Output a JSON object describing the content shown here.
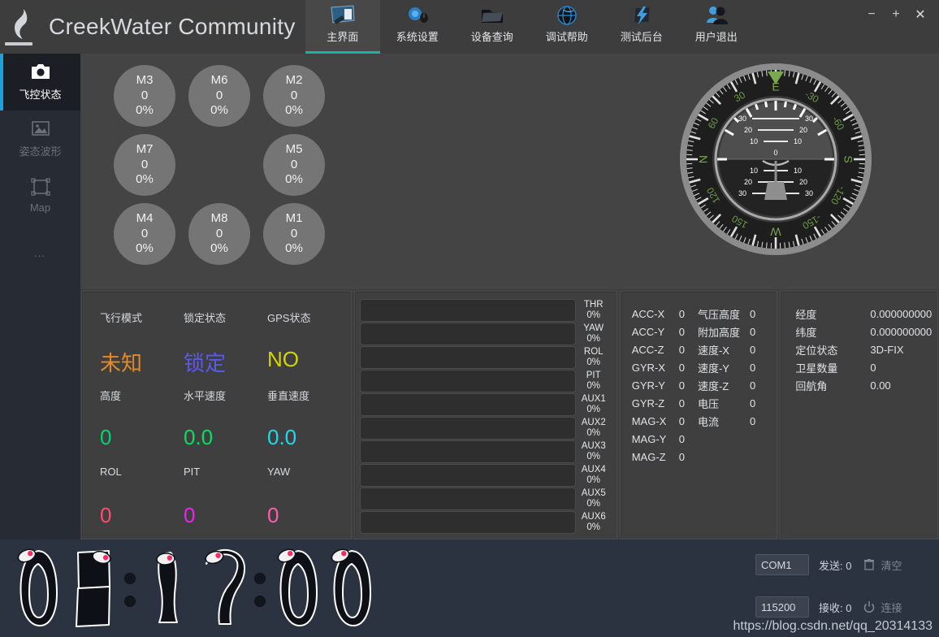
{
  "window": {
    "title": "CreekWater Community",
    "logo_icon": "flame-logo-icon",
    "minimize_label": "−",
    "maximize_label": "+",
    "close_label": "✕"
  },
  "tabs": [
    {
      "label": "主界面",
      "icon": "monitor-icon",
      "active": true
    },
    {
      "label": "系统设置",
      "icon": "mouse-gear-icon",
      "active": false
    },
    {
      "label": "设备查询",
      "icon": "folder-icon",
      "active": false
    },
    {
      "label": "调试帮助",
      "icon": "globe-icon",
      "active": false
    },
    {
      "label": "测试后台",
      "icon": "lightning-icon",
      "active": false
    },
    {
      "label": "用户退出",
      "icon": "users-icon",
      "active": false
    }
  ],
  "sidebar": {
    "items": [
      {
        "label": "飞控状态",
        "icon": "camera-icon",
        "active": true
      },
      {
        "label": "姿态波形",
        "icon": "image-icon",
        "active": false
      },
      {
        "label": "Map",
        "icon": "frame-icon",
        "active": false
      },
      {
        "label": "…",
        "icon": "more-dots-icon",
        "active": false
      }
    ]
  },
  "motors": [
    {
      "name": "M3",
      "value": "0",
      "percent": "0%"
    },
    {
      "name": "M6",
      "value": "0",
      "percent": "0%"
    },
    {
      "name": "M2",
      "value": "0",
      "percent": "0%"
    },
    {
      "name": "M7",
      "value": "0",
      "percent": "0%"
    },
    {
      "name": "M5",
      "value": "0",
      "percent": "0%"
    },
    {
      "name": "M4",
      "value": "0",
      "percent": "0%"
    },
    {
      "name": "M8",
      "value": "0",
      "percent": "0%"
    },
    {
      "name": "M1",
      "value": "0",
      "percent": "0%"
    }
  ],
  "attitude": {
    "heading_label": "E",
    "compass_cardinals": [
      "E",
      "S",
      "W",
      "N"
    ],
    "compass_degrees": [
      "30",
      "60",
      "-30",
      "-60",
      "120",
      "150",
      "-120",
      "-150"
    ],
    "pitch_ladder": [
      "30",
      "20",
      "10",
      "0",
      "10",
      "20",
      "30"
    ],
    "pitch_value": 0,
    "roll_value": 0
  },
  "status": {
    "flight_mode_label": "飞行模式",
    "flight_mode_value": "未知",
    "flight_mode_color": "#e08a2a",
    "lock_label": "锁定状态",
    "lock_value": "锁定",
    "lock_color": "#5a5ae8",
    "gps_label": "GPS状态",
    "gps_value": "NO",
    "gps_color": "#d4d400",
    "alt_label": "高度",
    "alt_value": "0",
    "alt_color": "#00d46a",
    "hspeed_label": "水平速度",
    "hspeed_value": "0.0",
    "hspeed_color": "#00e060",
    "vspeed_label": "垂直速度",
    "vspeed_value": "0.0",
    "vspeed_color": "#22d8e8",
    "rol_label": "ROL",
    "rol_value": "0",
    "rol_color": "#ff4d6d",
    "pit_label": "PIT",
    "pit_value": "0",
    "pit_color": "#ee22ee",
    "yaw_label": "YAW",
    "yaw_value": "0",
    "yaw_color": "#ff5fa8"
  },
  "channels": [
    {
      "name": "THR",
      "percent": "0%",
      "fill": 0
    },
    {
      "name": "YAW",
      "percent": "0%",
      "fill": 0
    },
    {
      "name": "ROL",
      "percent": "0%",
      "fill": 0
    },
    {
      "name": "PIT",
      "percent": "0%",
      "fill": 0
    },
    {
      "name": "AUX1",
      "percent": "0%",
      "fill": 0
    },
    {
      "name": "AUX2",
      "percent": "0%",
      "fill": 0
    },
    {
      "name": "AUX3",
      "percent": "0%",
      "fill": 0
    },
    {
      "name": "AUX4",
      "percent": "0%",
      "fill": 0
    },
    {
      "name": "AUX5",
      "percent": "0%",
      "fill": 0
    },
    {
      "name": "AUX6",
      "percent": "0%",
      "fill": 0
    }
  ],
  "sensors_left": [
    {
      "key": "ACC-X",
      "value": "0"
    },
    {
      "key": "ACC-Y",
      "value": "0"
    },
    {
      "key": "ACC-Z",
      "value": "0"
    },
    {
      "key": "GYR-X",
      "value": "0"
    },
    {
      "key": "GYR-Y",
      "value": "0"
    },
    {
      "key": "GYR-Z",
      "value": "0"
    },
    {
      "key": "MAG-X",
      "value": "0"
    },
    {
      "key": "MAG-Y",
      "value": "0"
    },
    {
      "key": "MAG-Z",
      "value": "0"
    }
  ],
  "sensors_right": [
    {
      "key": "气压高度",
      "value": "0"
    },
    {
      "key": "附加高度",
      "value": "0"
    },
    {
      "key": "速度-X",
      "value": "0"
    },
    {
      "key": "速度-Y",
      "value": "0"
    },
    {
      "key": "速度-Z",
      "value": "0"
    },
    {
      "key": "电压",
      "value": "0"
    },
    {
      "key": "电流",
      "value": "0"
    }
  ],
  "gps": [
    {
      "key": "经度",
      "value": "0.000000000"
    },
    {
      "key": "纬度",
      "value": "0.000000000"
    },
    {
      "key": "定位状态",
      "value": "3D-FIX"
    },
    {
      "key": "卫星数量",
      "value": "0"
    },
    {
      "key": "回航角",
      "value": "0.00"
    }
  ],
  "clock": {
    "time": "08:17:00",
    "digits": [
      "0",
      "8",
      ":",
      "1",
      "7",
      ":",
      "0",
      "0"
    ]
  },
  "connection": {
    "port_value": "COM1",
    "port_placeholder": "COM1",
    "baud_value": "115200",
    "baud_placeholder": "115200",
    "sent_label": "发送: 0",
    "recv_label": "接收: 0",
    "clear_label": "清空",
    "clear_icon": "trash-icon",
    "connect_label": "连接",
    "connect_icon": "power-icon"
  },
  "watermark": "https://blog.csdn.net/qq_20314133",
  "colors": {
    "accent_tab": "#16b79a",
    "accent_sidebar": "#1ea0e0",
    "titlebar_bg": "#3d3d3d",
    "content_bg": "#444444",
    "bottom_bg": "#2b3240"
  }
}
